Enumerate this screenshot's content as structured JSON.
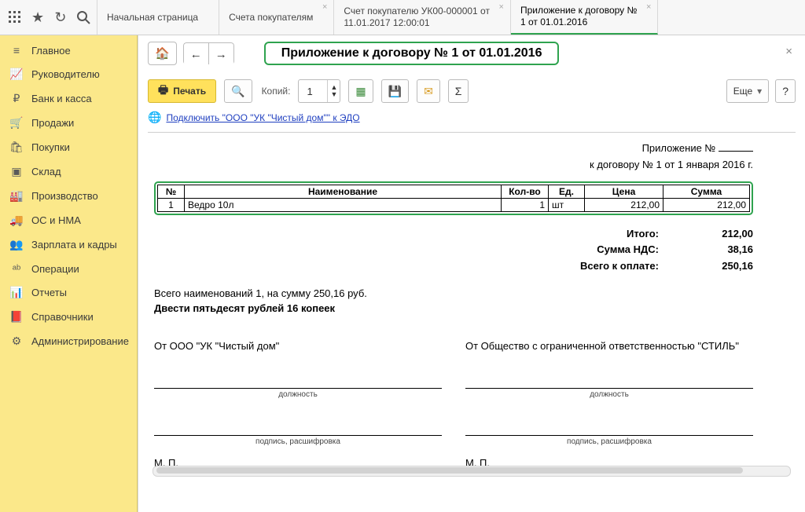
{
  "topbar": {
    "tabs": [
      {
        "line1": "Начальная страница",
        "line2": "",
        "closable": false
      },
      {
        "line1": "Счета покупателям",
        "line2": "",
        "closable": true
      },
      {
        "line1": "Счет покупателю УК00-000001 от",
        "line2": "11.01.2017 12:00:01",
        "closable": true
      },
      {
        "line1": "Приложение к договору №",
        "line2": "1 от 01.01.2016",
        "closable": true
      }
    ],
    "active_tab": 3
  },
  "sidebar": [
    {
      "icon": "≡",
      "label": "Главное"
    },
    {
      "icon": "📈",
      "label": "Руководителю"
    },
    {
      "icon": "₽",
      "label": "Банк и касса"
    },
    {
      "icon": "🛒",
      "label": "Продажи"
    },
    {
      "icon": "🛍",
      "label": "Покупки"
    },
    {
      "icon": "▣",
      "label": "Склад"
    },
    {
      "icon": "🏭",
      "label": "Производство"
    },
    {
      "icon": "🚚",
      "label": "ОС и НМА"
    },
    {
      "icon": "👥",
      "label": "Зарплата и кадры"
    },
    {
      "icon": "ᵃᵇ",
      "label": "Операции"
    },
    {
      "icon": "📊",
      "label": "Отчеты"
    },
    {
      "icon": "📕",
      "label": "Справочники"
    },
    {
      "icon": "⚙",
      "label": "Администрирование"
    }
  ],
  "page_title": "Приложение к договору № 1 от 01.01.2016",
  "toolbar": {
    "print": "Печать",
    "copies_label": "Копий:",
    "copies_value": "1",
    "more": "Еще"
  },
  "edo": {
    "link": "Подключить \"ООО \"УК \"Чистый дом\"\" к ЭДО"
  },
  "doc": {
    "head_line1_prefix": "Приложение №",
    "head_line2": "к договору № 1 от 1 января 2016 г.",
    "columns": {
      "num": "№",
      "name": "Наименование",
      "qty": "Кол-во",
      "unit": "Ед.",
      "price": "Цена",
      "sum": "Сумма"
    },
    "rows": [
      {
        "num": "1",
        "name": "Ведро 10л",
        "qty": "1",
        "unit": "шт",
        "price": "212,00",
        "sum": "212,00"
      }
    ],
    "totals": {
      "itogo_lbl": "Итого:",
      "itogo_val": "212,00",
      "nds_lbl": "Сумма НДС:",
      "nds_val": "38,16",
      "pay_lbl": "Всего к оплате:",
      "pay_val": "250,16"
    },
    "count_line": "Всего наименований 1, на сумму 250,16 руб.",
    "amount_words": "Двести пятьдесят рублей 16 копеек",
    "party_left": "От ООО \"УК \"Чистый дом\"",
    "party_right": "От Общество с ограниченной ответственностью \"СТИЛЬ\"",
    "sig_position": "должность",
    "sig_sign": "подпись, расшифровка",
    "mp": "М. П."
  }
}
